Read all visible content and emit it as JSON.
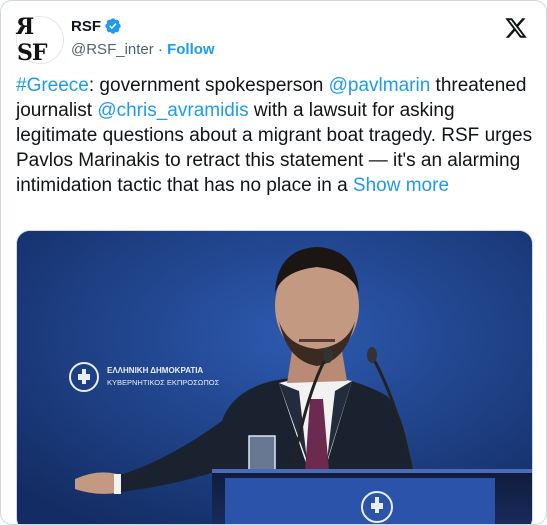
{
  "author": {
    "display_name": "RSF",
    "handle": "@RSF_inter",
    "separator": "·",
    "follow_label": "Follow",
    "avatar_text_a": "R",
    "avatar_text_b": "S",
    "avatar_text_c": "F",
    "verified": true
  },
  "tweet": {
    "hashtag": "#Greece",
    "text_1": ": government spokesperson ",
    "mention_1": "@pavlmarin",
    "text_2": " threatened journalist ",
    "mention_2": "@chris_avramidis",
    "text_3": " with a lawsuit for asking legitimate questions about a migrant boat tragedy. RSF urges Pavlos Marinakis to retract this statement — it's an alarming intimidation tactic that has no place in a ",
    "show_more": "Show more"
  },
  "media": {
    "podium_sign_line_1": "ΕΛΛΗΝΙΚΗ ΔΗΜΟΚΡΑΤΙΑ",
    "podium_sign_line_2": "ΚΥΒΕΡΝΗΤΙΚΟΣ ΕΚΠΡΟΣΩΠΟΣ"
  },
  "colors": {
    "link": "#1d9bf0",
    "text": "#0f1419",
    "secondary": "#536471",
    "backdrop": "#1c3a7a"
  },
  "icons": {
    "verified": "verified-badge-icon",
    "platform": "x-logo-icon",
    "emblem": "greek-emblem-icon"
  }
}
